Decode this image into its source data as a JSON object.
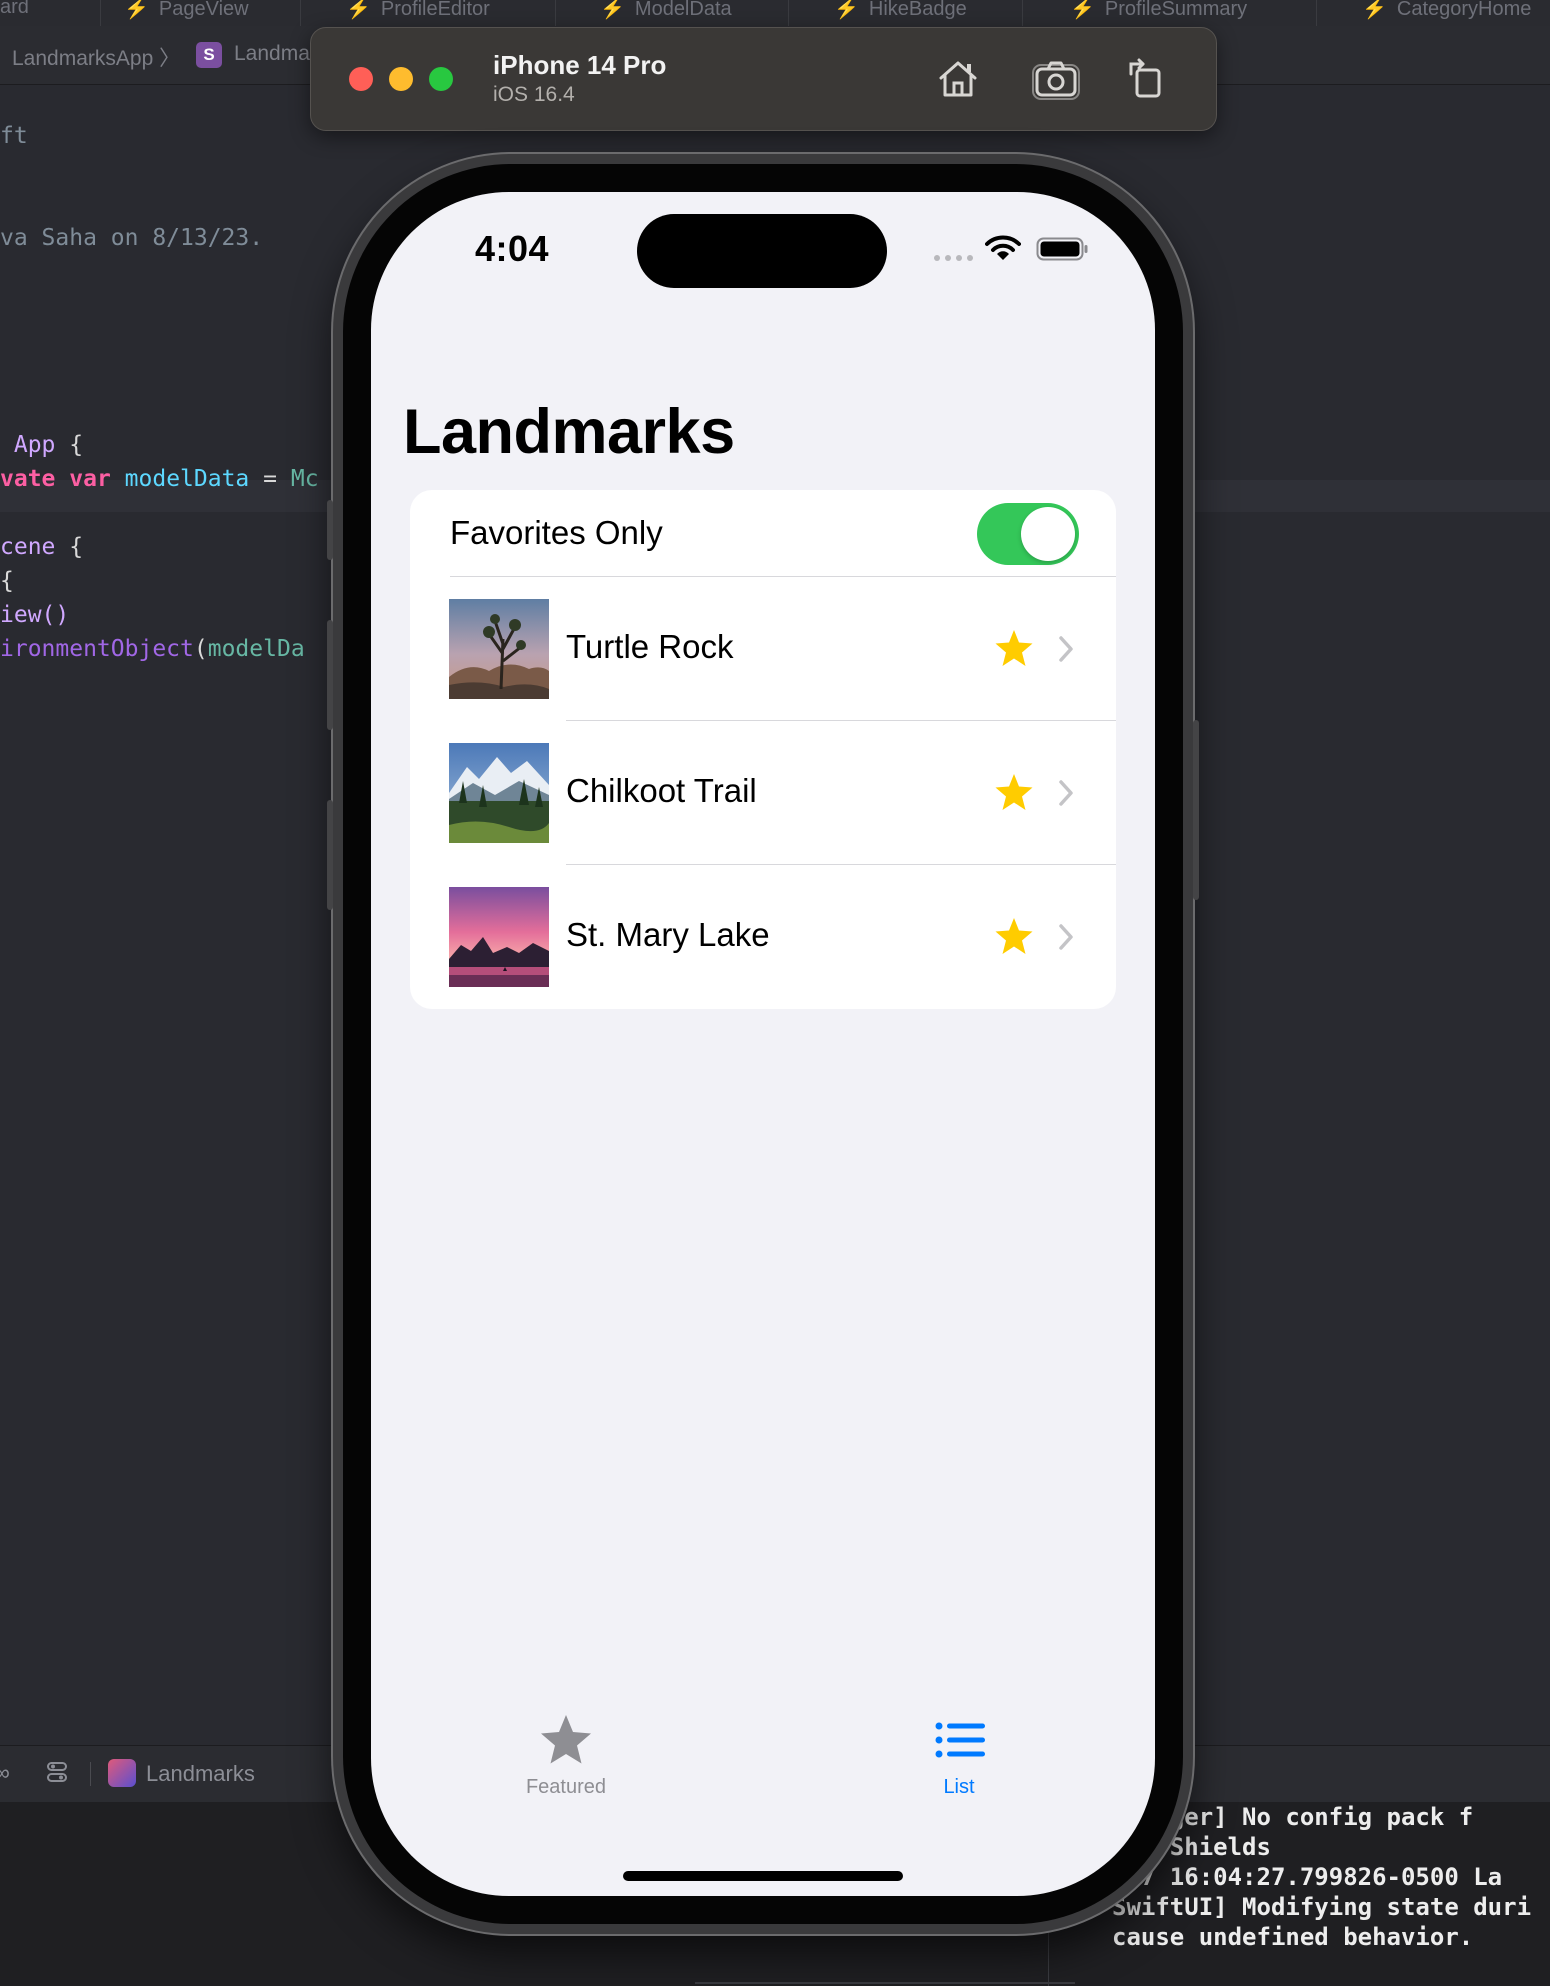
{
  "xcode": {
    "file_tabs": [
      "ard",
      "PageView",
      "ProfileEditor",
      "ModelData",
      "HikeBadge",
      "ProfileSummary",
      "CategoryHome"
    ],
    "breadcrumb": {
      "project": "LandmarksApp",
      "file": "Landma"
    },
    "code_lines": {
      "comment_filename": "ft",
      "comment_author": "va Saha on 8/13/23.",
      "struct_line_type": "App",
      "struct_line_brace": "{",
      "var_kw1": "vate",
      "var_kw2": "var",
      "var_name": "modelData",
      "var_eq": "=",
      "var_type": "Mc",
      "scene_kw": "cene",
      "scene_brace": "{",
      "brace": "{",
      "view_call": "iew()",
      "env_fn": "ironmentObject",
      "env_arg_open": "(",
      "env_arg": "modelDa"
    },
    "scheme_label": "Landmarks",
    "console_lines": [
      "Manager] No config pack f",
      "ica Shields",
      "-07 16:04:27.799826-0500 La",
      "SwiftUI] Modifying state duri",
      "cause undefined behavior."
    ]
  },
  "simulator": {
    "device_name": "iPhone 14 Pro",
    "os_version": "iOS 16.4",
    "toolbar_icons": [
      "home-icon",
      "screenshot-icon",
      "rotate-icon"
    ]
  },
  "phone": {
    "status_time": "4:04",
    "title": "Landmarks",
    "favorites_toggle": {
      "label": "Favorites Only",
      "on": true
    },
    "rows": [
      {
        "name": "Turtle Rock",
        "favorite": true
      },
      {
        "name": "Chilkoot Trail",
        "favorite": true
      },
      {
        "name": "St. Mary Lake",
        "favorite": true
      }
    ],
    "tabs": [
      {
        "label": "Featured",
        "icon": "star-fill-icon",
        "selected": false
      },
      {
        "label": "List",
        "icon": "list-bullet-icon",
        "selected": true
      }
    ]
  },
  "colors": {
    "accent": "#007aff",
    "toggle_on": "#34c759",
    "star": "#ffcc00",
    "background": "#f2f2f7"
  }
}
